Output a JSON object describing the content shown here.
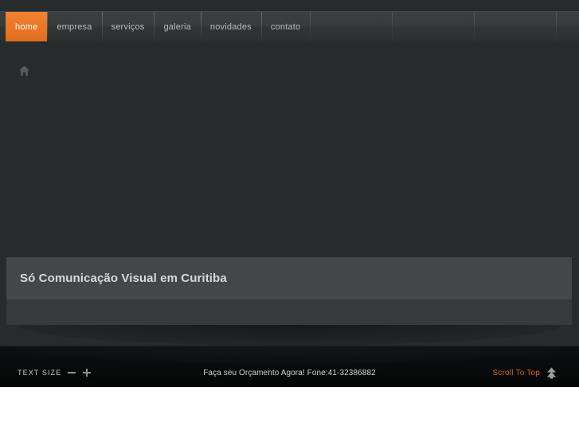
{
  "nav": {
    "items": [
      {
        "label": "home",
        "active": true,
        "name": "nav-item-home"
      },
      {
        "label": "empresa",
        "active": false,
        "name": "nav-item-empresa"
      },
      {
        "label": "serviços",
        "active": false,
        "name": "nav-item-servicos"
      },
      {
        "label": "galeria",
        "active": false,
        "name": "nav-item-galeria"
      },
      {
        "label": "novidades",
        "active": false,
        "name": "nav-item-novidades"
      },
      {
        "label": "contato",
        "active": false,
        "name": "nav-item-contato"
      }
    ]
  },
  "breadcrumb": {
    "home_icon": "home-icon"
  },
  "main": {
    "page_title": "Só Comunicação Visual em Curitiba"
  },
  "footer": {
    "text_size_label": "TEXT SIZE",
    "decrease_icon": "minus-icon",
    "increase_icon": "plus-icon",
    "center_text": "Faça seu Orçamento Agora! Fone:41-32386882",
    "scroll_to_top_label": "Scroll To Top",
    "scroll_to_top_icon": "arrow-up-icon"
  },
  "colors": {
    "accent_orange": "#ea7626",
    "scroll_link_orange": "#d4641f",
    "page_background": "#262b2b",
    "nav_background": "#363b3b",
    "panel_heading": "#424747",
    "panel_body": "#353a3a",
    "footer_background": "#070a0a"
  }
}
